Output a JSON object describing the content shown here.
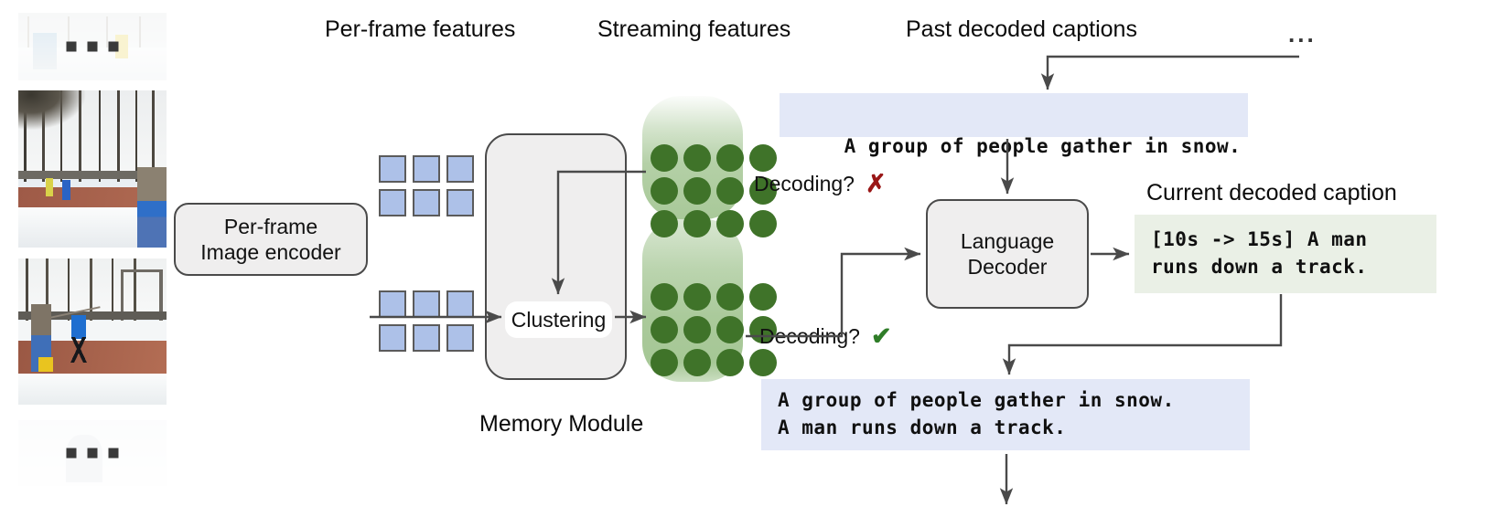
{
  "figure": {
    "title": "Streaming dense video captioning architecture",
    "accent_blue": "#adc1e8",
    "accent_green": "#3f7329",
    "caption_blue_bg": "#e3e8f7",
    "caption_green_bg": "#eaf0e6",
    "module_bg": "#efeeee"
  },
  "labels": {
    "per_frame_features": "Per-frame features",
    "streaming_features": "Streaming features",
    "past_decoded_captions": "Past decoded captions",
    "current_decoded_caption": "Current decoded caption",
    "memory_module": "Memory Module",
    "ellipsis": "..."
  },
  "modules": {
    "image_encoder": "Per-frame\nImage encoder",
    "image_encoder_line1": "Per-frame",
    "image_encoder_line2": "Image encoder",
    "clustering": "Clustering",
    "language_decoder_line1": "Language",
    "language_decoder_line2": "Decoder"
  },
  "decoding": {
    "question": "Decoding?",
    "negative_mark": "✗",
    "positive_mark": "✔"
  },
  "captions": {
    "past": "A group of people gather in snow.",
    "current_line1": "[10s -> 15s] A man",
    "current_line2": "runs down a track.",
    "accumulated_line1": "A group of people gather in snow.",
    "accumulated_line2": "A man runs down a track."
  },
  "frames": [
    {
      "name": "frame-faded-top",
      "dots": "...",
      "faded": true
    },
    {
      "name": "frame-snowy-park",
      "dots": "",
      "faded": false
    },
    {
      "name": "frame-javelin-thrower",
      "dots": "",
      "faded": false
    },
    {
      "name": "frame-faded-bottom",
      "dots": "...",
      "faded": true
    }
  ],
  "feature_grids": {
    "upper_cols": 3,
    "upper_rows": 2,
    "lower_cols": 3,
    "lower_rows": 2
  },
  "memory_tokens": {
    "upper_cols": 4,
    "upper_rows": 3,
    "lower_cols": 4,
    "lower_rows": 3
  }
}
